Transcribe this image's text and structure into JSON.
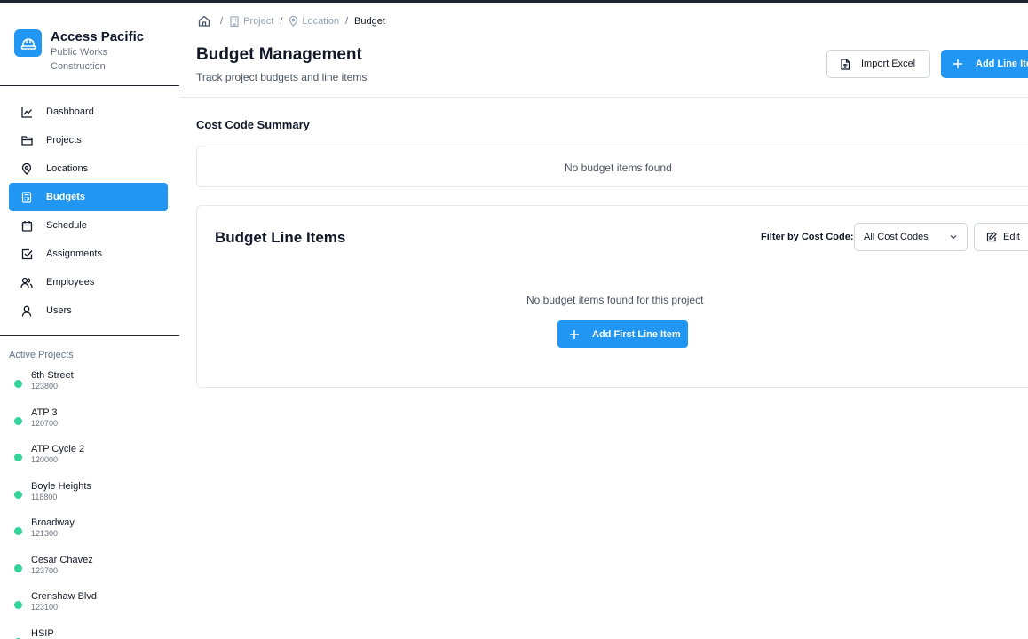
{
  "brand": {
    "name": "Access Pacific",
    "subtitle": "Public Works Construction"
  },
  "nav": [
    {
      "label": "Dashboard",
      "icon": "chart-line-icon",
      "active": false
    },
    {
      "label": "Projects",
      "icon": "folder-icon",
      "active": false
    },
    {
      "label": "Locations",
      "icon": "map-pin-icon",
      "active": false
    },
    {
      "label": "Budgets",
      "icon": "calculator-icon",
      "active": true
    },
    {
      "label": "Schedule",
      "icon": "calendar-icon",
      "active": false
    },
    {
      "label": "Assignments",
      "icon": "check-square-icon",
      "active": false
    },
    {
      "label": "Employees",
      "icon": "users-icon",
      "active": false
    },
    {
      "label": "Users",
      "icon": "user-icon",
      "active": false
    }
  ],
  "active_projects": {
    "title": "Active Projects",
    "items": [
      {
        "name": "6th Street",
        "number": "123800"
      },
      {
        "name": "ATP 3",
        "number": "120700"
      },
      {
        "name": "ATP Cycle 2",
        "number": "120000"
      },
      {
        "name": "Boyle Heights",
        "number": "118800"
      },
      {
        "name": "Broadway",
        "number": "121300"
      },
      {
        "name": "Cesar Chavez",
        "number": "123700"
      },
      {
        "name": "Crenshaw Blvd",
        "number": "123100"
      },
      {
        "name": "HSIP",
        "number": ""
      }
    ]
  },
  "breadcrumb": {
    "project": "Project",
    "location": "Location",
    "current": "Budget",
    "separator": "/"
  },
  "header": {
    "title": "Budget Management",
    "subtitle": "Track project budgets and line items",
    "import_label": "Import Excel",
    "add_label": "Add Line Item"
  },
  "summary": {
    "title": "Cost Code Summary",
    "empty": "No budget items found"
  },
  "line_items": {
    "title": "Budget Line Items",
    "filter_label": "Filter by Cost Code:",
    "filter_value": "All Cost Codes",
    "edit_label": "Edit",
    "empty": "No budget items found for this project",
    "add_first_label": "Add First Line Item"
  },
  "colors": {
    "accent": "#2196f3",
    "status_active": "#34d399"
  }
}
